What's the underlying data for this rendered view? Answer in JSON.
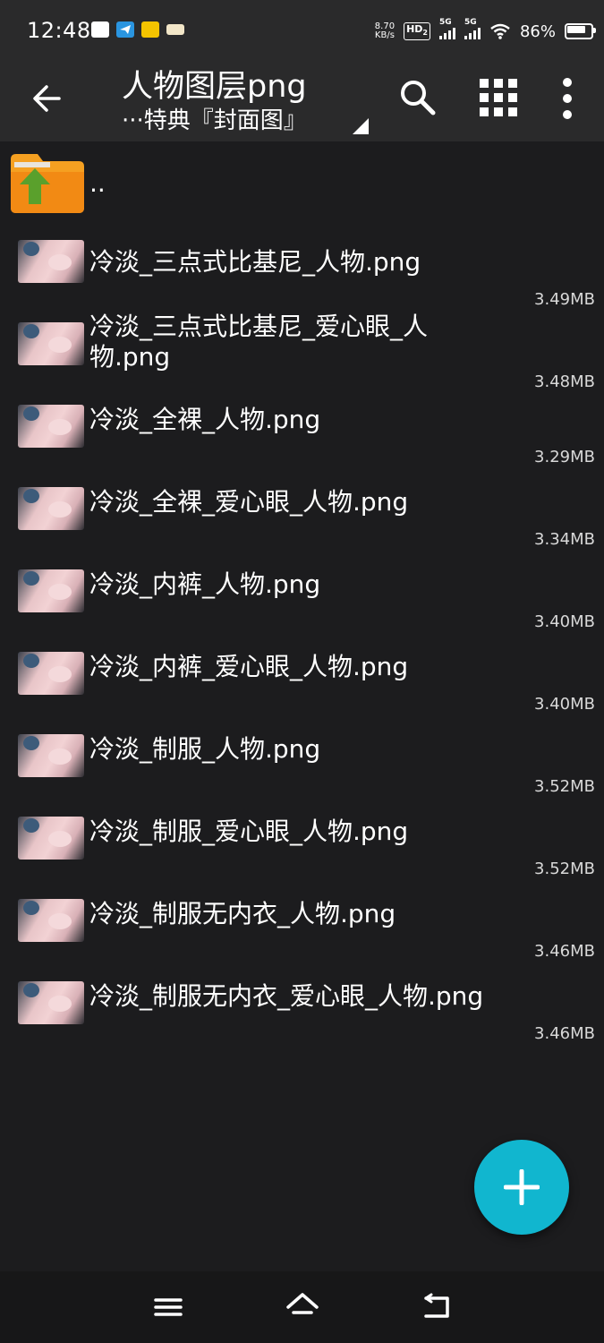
{
  "status_bar": {
    "time": "12:48",
    "net_speed_value": "8.70",
    "net_speed_unit": "KB/s",
    "hd_label": "HD",
    "hd_sub": "2",
    "signal1_label": "5G",
    "signal2_label": "5G",
    "battery_percent": "86%"
  },
  "app_bar": {
    "title": "人物图层png",
    "subtitle": "···特典『封面图』"
  },
  "parent_dir": {
    "label": ".."
  },
  "files": [
    {
      "name": "冷淡_三点式比基尼_人物.png",
      "size": "3.49MB"
    },
    {
      "name": "冷淡_三点式比基尼_爱心眼_人物.png",
      "size": "3.48MB"
    },
    {
      "name": "冷淡_全裸_人物.png",
      "size": "3.29MB"
    },
    {
      "name": "冷淡_全裸_爱心眼_人物.png",
      "size": "3.34MB"
    },
    {
      "name": "冷淡_内裤_人物.png",
      "size": "3.40MB"
    },
    {
      "name": "冷淡_内裤_爱心眼_人物.png",
      "size": "3.40MB"
    },
    {
      "name": "冷淡_制服_人物.png",
      "size": "3.52MB"
    },
    {
      "name": "冷淡_制服_爱心眼_人物.png",
      "size": "3.52MB"
    },
    {
      "name": "冷淡_制服无内衣_人物.png",
      "size": "3.46MB"
    },
    {
      "name": "冷淡_制服无内衣_爱心眼_人物.png",
      "size": "3.46MB"
    }
  ],
  "colors": {
    "background": "#1c1c1e",
    "app_bar": "#2a2a2b",
    "fab": "#11b6cf",
    "folder": "#f5a021",
    "folder_arrow": "#5aa02c"
  }
}
